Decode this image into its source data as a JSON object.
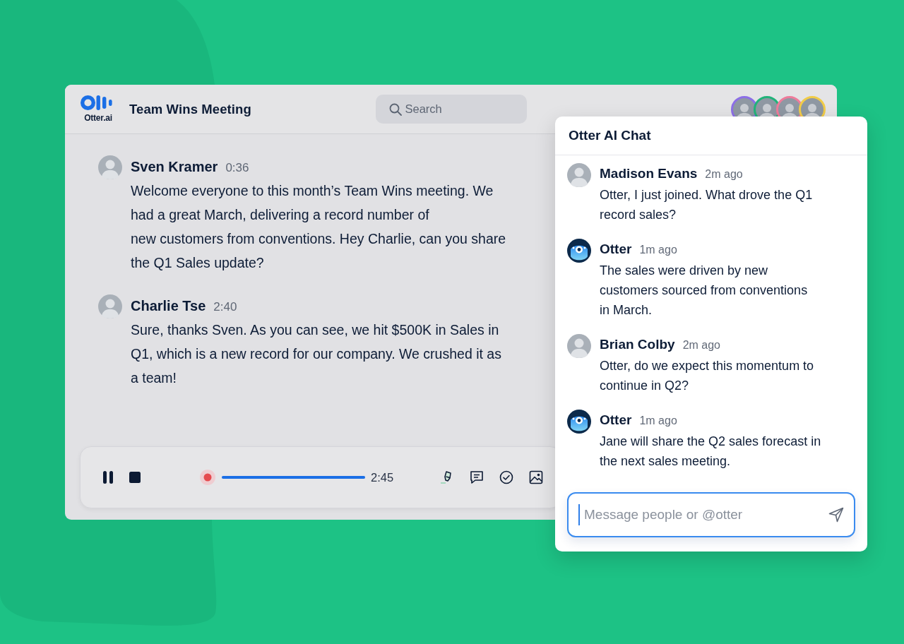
{
  "window": {
    "logo_text": "Otter.ai",
    "title": "Team Wins Meeting"
  },
  "search": {
    "placeholder": "Search"
  },
  "participants": [
    {
      "color": "#8c6fe6"
    },
    {
      "color": "#22b37a"
    },
    {
      "color": "#ee7c9b"
    },
    {
      "color": "#f1cc48"
    }
  ],
  "transcript": [
    {
      "speaker": "Sven Kramer",
      "time": "0:36",
      "text": "Welcome everyone to this month’s Team Wins meeting. We\nhad a great March, delivering a record number of\nnew customers from conventions. Hey Charlie, can you share\nthe Q1 Sales update?"
    },
    {
      "speaker": "Charlie Tse",
      "time": "2:40",
      "text": "Sure, thanks Sven. As you can see, we hit $500K in Sales in\nQ1, which is a new record for our company. We crushed it as\na team!"
    }
  ],
  "player": {
    "level": 1,
    "time": "2:45"
  },
  "chat": {
    "title": "Otter AI Chat",
    "messages": [
      {
        "kind": "person",
        "author": "Madison Evans",
        "time": "2m ago",
        "text": "Otter, I just joined. What drove the Q1\nrecord sales?"
      },
      {
        "kind": "bot",
        "author": "Otter",
        "time": "1m ago",
        "text": "The sales were driven by new\ncustomers sourced from conventions\nin March."
      },
      {
        "kind": "person",
        "author": "Brian Colby",
        "time": "2m ago",
        "text": "Otter, do we expect this momentum to\ncontinue in Q2?"
      },
      {
        "kind": "bot",
        "author": "Otter",
        "time": "1m ago",
        "text": "Jane will share the Q2 sales forecast in\nthe next sales meeting."
      }
    ],
    "input": {
      "placeholder": "Message people or @otter"
    }
  }
}
